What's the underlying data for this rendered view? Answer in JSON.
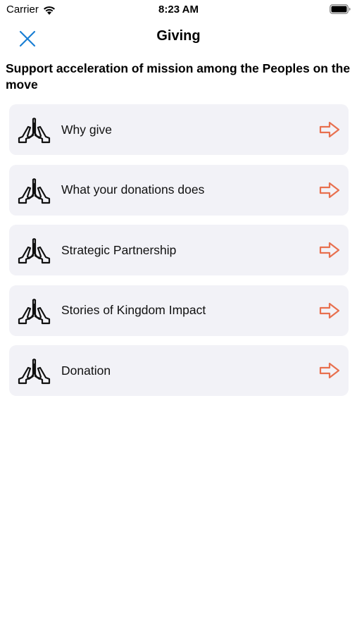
{
  "status_bar": {
    "carrier": "Carrier",
    "time": "8:23 AM",
    "wifi_icon": "wifi-icon",
    "battery_icon": "battery-icon"
  },
  "nav": {
    "title": "Giving",
    "close_icon": "close-icon",
    "accent_color": "#1a7fd4"
  },
  "headline": "Support acceleration of mission among the Peoples on the move",
  "menu": {
    "icon": "praying-hands-icon",
    "arrow_icon": "arrow-right-icon",
    "arrow_color": "#e8704f",
    "items": [
      {
        "label": "Why give"
      },
      {
        "label": "What your donations does"
      },
      {
        "label": "Strategic Partnership"
      },
      {
        "label": "Stories of Kingdom Impact"
      },
      {
        "label": "Donation"
      }
    ]
  }
}
